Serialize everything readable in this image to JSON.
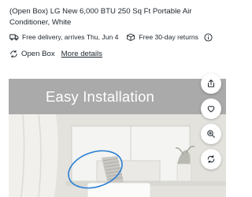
{
  "product": {
    "title": "(Open Box) LG New 6,000 BTU 250 Sq Ft Portable Air Conditioner, White"
  },
  "fulfillment": {
    "delivery_text": "Free delivery, arrives Thu, Jun 4",
    "returns_text": "Free 30-day returns"
  },
  "condition": {
    "label": "Open Box",
    "link_text": "More details"
  },
  "gallery": {
    "caption": "Easy Installation"
  },
  "icons": {
    "delivery": "truck-icon",
    "returns": "return-box-icon",
    "info": "info-icon",
    "open_box": "recycle-icon",
    "share": "share-icon",
    "favorite": "heart-icon",
    "zoom": "zoom-in-icon",
    "rotate": "360-view-icon"
  },
  "colors": {
    "text": "#1d252c",
    "hero_background": "#a9aaa9",
    "annotation_circle": "#2a7fd4"
  }
}
